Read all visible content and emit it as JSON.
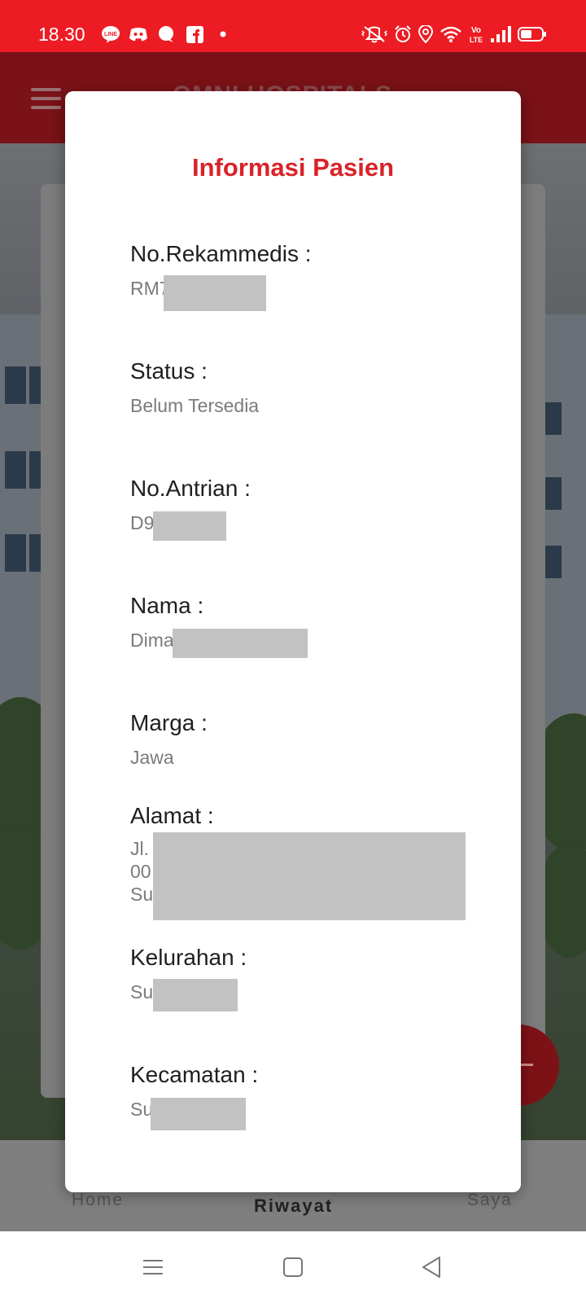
{
  "status_bar": {
    "time": "18.30",
    "left_icons": [
      "line-icon",
      "discord-icon",
      "chat-bubble-icon",
      "facebook-icon",
      "dot-icon"
    ],
    "right_icons": [
      "mute-vibrate-icon",
      "alarm-icon",
      "location-icon",
      "wifi-icon",
      "volte-icon",
      "signal-icon",
      "battery-icon"
    ],
    "volte_text": "Vo\nLTE"
  },
  "app": {
    "header_title": "OMNI HOSPITALS",
    "bottom_nav": [
      {
        "label": "Home",
        "active": false
      },
      {
        "label": "Riwayat",
        "active": true
      },
      {
        "label": "Saya",
        "active": false
      }
    ]
  },
  "modal": {
    "title": "Informasi Pasien",
    "fields": [
      {
        "label": "No.Rekammedis :",
        "value": "RM7"
      },
      {
        "label": "Status :",
        "value": "Belum Tersedia"
      },
      {
        "label": "No.Antrian :",
        "value": "D9"
      },
      {
        "label": "Nama :",
        "value": "Dima"
      },
      {
        "label": "Marga :",
        "value": "Jawa"
      },
      {
        "label": "Alamat :",
        "value_lines": [
          "Jl.",
          "00",
          "Su"
        ]
      },
      {
        "label": "Kelurahan :",
        "value": "Su"
      },
      {
        "label": "Kecamatan :",
        "value": "Su"
      }
    ]
  },
  "colors": {
    "status_bar": "#ed1c24",
    "modal_title": "#d8232a",
    "redaction": "#c2c2c2"
  }
}
